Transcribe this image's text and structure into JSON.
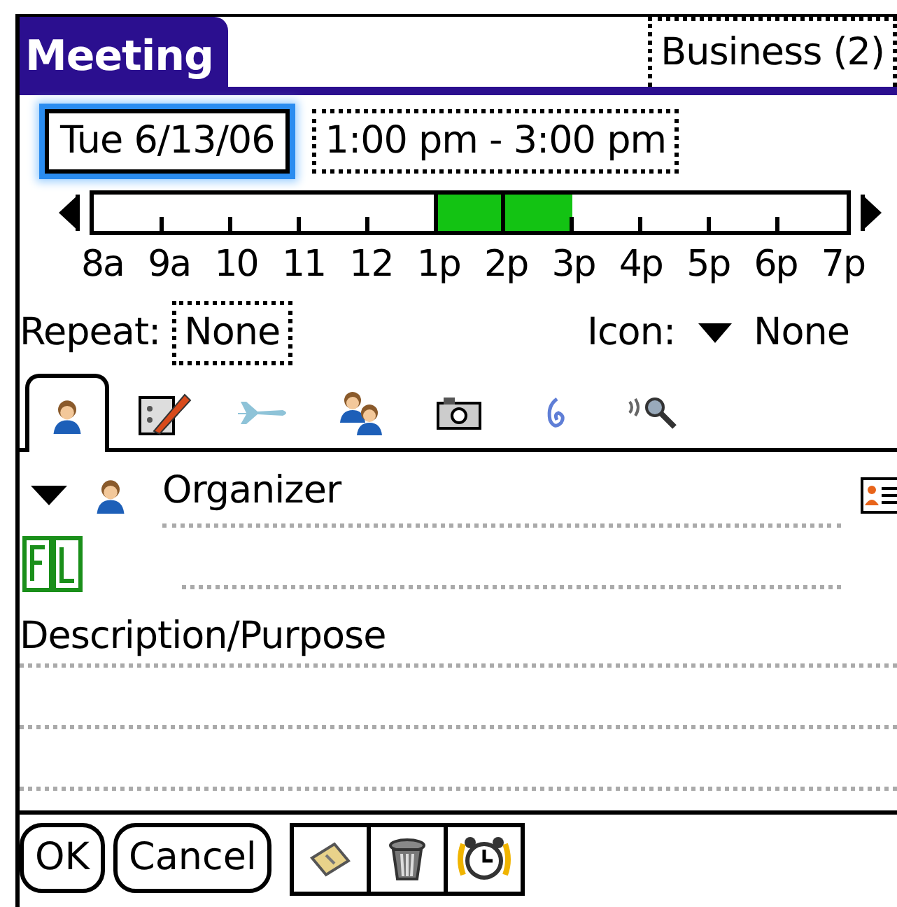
{
  "title": "Meeting",
  "category": "Business (2)",
  "date": "Tue 6/13/06",
  "time": "1:00 pm - 3:00 pm",
  "timeline": {
    "labels": [
      "8a",
      "9a",
      "10",
      "11",
      "12",
      "1p",
      "2p",
      "3p",
      "4p",
      "5p",
      "6p",
      "7p"
    ],
    "segments": [
      {
        "selected": false
      },
      {
        "selected": false
      },
      {
        "selected": false
      },
      {
        "selected": false
      },
      {
        "selected": false
      },
      {
        "selected": true
      },
      {
        "selected": true
      },
      {
        "selected": false
      },
      {
        "selected": false
      },
      {
        "selected": false
      },
      {
        "selected": false
      }
    ]
  },
  "repeat": {
    "label": "Repeat:",
    "value": "None"
  },
  "icon": {
    "label": "Icon:",
    "value": "None"
  },
  "tabs": [
    {
      "kind": "person",
      "selected": true
    },
    {
      "kind": "edit",
      "selected": false
    },
    {
      "kind": "plane",
      "selected": false
    },
    {
      "kind": "people",
      "selected": false
    },
    {
      "kind": "camera",
      "selected": false
    },
    {
      "kind": "swirl",
      "selected": false
    },
    {
      "kind": "search",
      "selected": false
    }
  ],
  "organizer": "Organizer",
  "description": "Description/Purpose",
  "buttons": [
    "OK",
    "Cancel"
  ],
  "tool_buttons": [
    {
      "kind": "note"
    },
    {
      "kind": "trash"
    },
    {
      "kind": "alarm"
    }
  ]
}
